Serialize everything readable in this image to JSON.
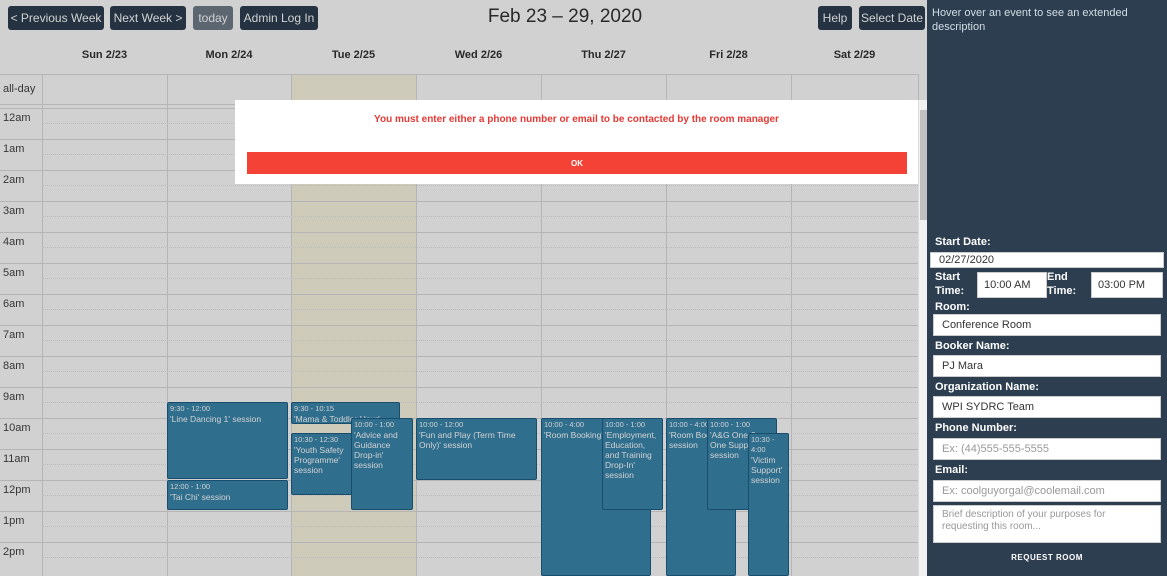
{
  "toolbar": {
    "prev_label": "< Previous Week",
    "next_label": "Next Week >",
    "today_label": "today",
    "admin_label": "Admin Log In",
    "title": "Feb 23 – 29, 2020",
    "help_label": "Help",
    "select_date_label": "Select Date"
  },
  "days": [
    "Sun 2/23",
    "Mon 2/24",
    "Tue 2/25",
    "Wed 2/26",
    "Thu 2/27",
    "Fri 2/28",
    "Sat 2/29"
  ],
  "allday_label": "all-day",
  "times": [
    "12am",
    "1am",
    "2am",
    "3am",
    "4am",
    "5am",
    "6am",
    "7am",
    "8am",
    "9am",
    "10am",
    "11am",
    "12pm",
    "1pm",
    "2pm"
  ],
  "events": [
    {
      "time": "9:30 - 12:00",
      "title": "'Line Dancing 1' session"
    },
    {
      "time": "12:00 - 1:00",
      "title": "'Tai Chi' session"
    },
    {
      "time": "9:30 - 10:15",
      "title": "'Mama & Toddler Hour'"
    },
    {
      "time": "10:30 - 12:30",
      "title": "'Youth Safety Programme' session"
    },
    {
      "time": "10:00 - 1:00",
      "title": "'Advice and Guidance Drop-in' session"
    },
    {
      "time": "10:00 - 12:00",
      "title": "'Fun and Play (Term Time Only)' session"
    },
    {
      "time": "10:00 - 4:00",
      "title": "'Room Booking' session"
    },
    {
      "time": "10:00 - 1:00",
      "title": "'Employment, Education, and Training Drop-In' session"
    },
    {
      "time": "10:00 - 4:00",
      "title": "'Room Booking' session"
    },
    {
      "time": "10:00 - 1:00",
      "title": "'A&G One-2-One Support' session"
    },
    {
      "time": "10:30 - 4:00",
      "title": "'Victim Support' session"
    }
  ],
  "sidebar": {
    "hover_hint": "Hover over an event to see an extended description",
    "start_date_label": "Start Date:",
    "start_date_value": "02/27/2020",
    "start_time_label": "Start Time:",
    "start_time_value": "10:00 AM",
    "end_time_label": "End Time:",
    "end_time_value": "03:00 PM",
    "room_label": "Room:",
    "room_value": "Conference Room",
    "booker_label": "Booker Name:",
    "booker_value": "PJ Mara",
    "org_label": "Organization Name:",
    "org_value": "WPI SYDRC Team",
    "phone_label": "Phone Number:",
    "phone_placeholder": "Ex: (44)555-555-5555",
    "email_label": "Email:",
    "email_placeholder": "Ex: coolguyorgal@coolemail.com",
    "desc_placeholder": "Brief description of your purposes for requesting this room...",
    "request_label": "REQUEST ROOM"
  },
  "modal": {
    "message": "You must enter either a phone number or email to be contacted by the room manager",
    "ok_label": "OK"
  },
  "colors": {
    "event": "#3a87ad",
    "sidebar": "#2c3e50",
    "error": "#e53935",
    "ok_button": "#f44336",
    "today_column": "#fcf8e3"
  }
}
